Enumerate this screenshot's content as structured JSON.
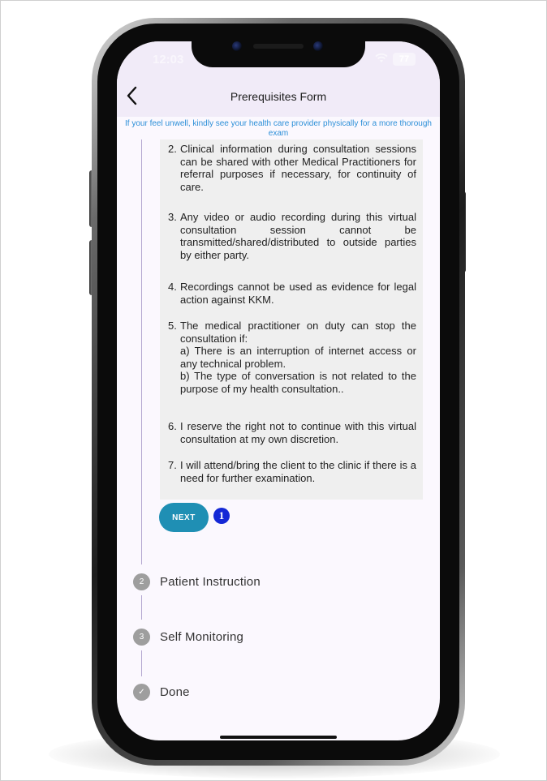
{
  "status_bar": {
    "time": "12:03",
    "battery": "77"
  },
  "header": {
    "title": "Prerequisites Form"
  },
  "warning": "If your feel unwell, kindly see your health care provider physically for a more thorough exam",
  "terms": [
    {
      "number": "2.",
      "text": "Clinical information during consultation sessions can be shared with other Medical Practitioners for referral purposes if necessary, for continuity of care."
    },
    {
      "number": "3.",
      "text": "Any video or audio recording during this virtual consultation session cannot be transmitted/shared/distributed to outside parties by either party."
    },
    {
      "number": "4.",
      "text": "Recordings cannot be used as evidence for legal action against KKM."
    },
    {
      "number": "5.",
      "text": "The medical practitioner on duty can stop the consultation if:\na) There is an interruption of internet access or any technical problem.\nb) The type of conversation is not related to the purpose of my health consultation.."
    },
    {
      "number": "6.",
      "text": "I reserve the right not to continue with this virtual consultation at my own discretion."
    },
    {
      "number": "7.",
      "text": "I will attend/bring the client to the clinic if there is a need for further examination."
    }
  ],
  "next_button": {
    "label": "NEXT"
  },
  "annotation_badge": "1",
  "steps": [
    {
      "number": "2",
      "label": "Patient Instruction"
    },
    {
      "number": "3",
      "label": "Self Monitoring"
    },
    {
      "number": "✓",
      "label": "Done"
    }
  ]
}
